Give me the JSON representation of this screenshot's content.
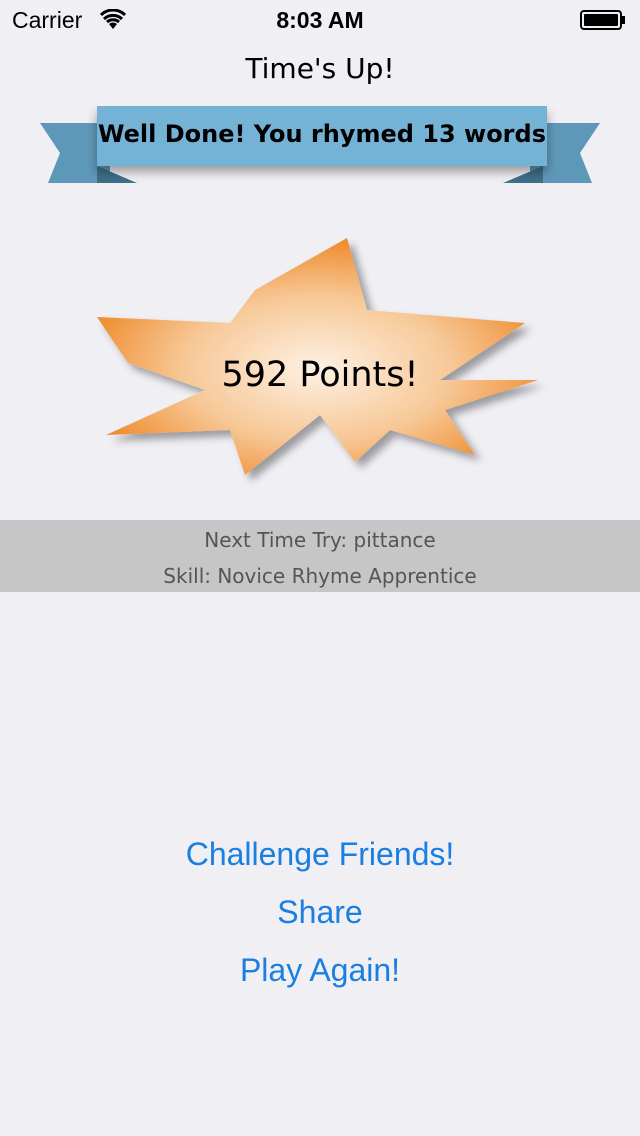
{
  "status_bar": {
    "carrier": "Carrier",
    "time": "8:03 AM"
  },
  "screen": {
    "title": "Time's Up!",
    "ribbon_text": "Well Done! You rhymed 13 words",
    "score_text": "592 Points!",
    "next_try": "Next Time Try: pittance",
    "skill": "Skill: Novice Rhyme Apprentice"
  },
  "actions": {
    "challenge": "Challenge Friends!",
    "share": "Share",
    "play_again": "Play Again!"
  },
  "colors": {
    "background": "#efeff4",
    "ribbon": "#74b3d6",
    "ribbon_dark": "#5e98b8",
    "burst_center": "#fdf1e3",
    "burst_edge": "#ef8a2a",
    "info_band": "#c6c6c6",
    "link": "#1a7fe0"
  }
}
